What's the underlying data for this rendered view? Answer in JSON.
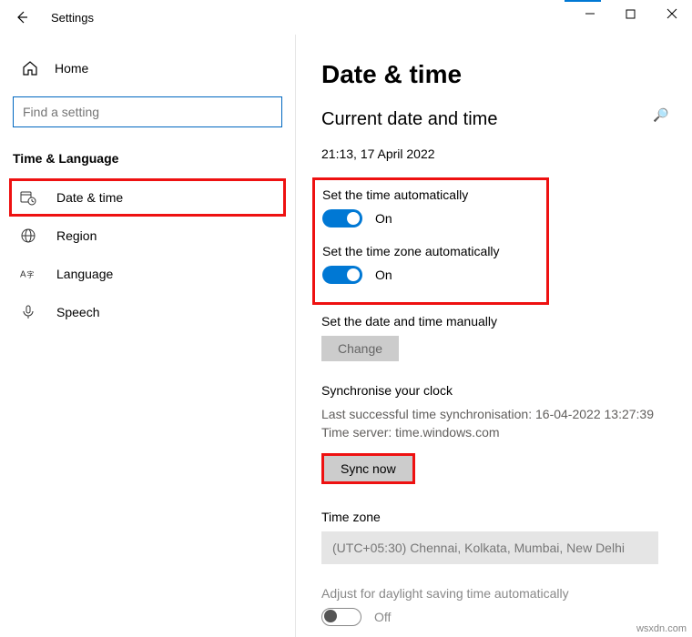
{
  "window": {
    "title": "Settings"
  },
  "sidebar": {
    "home": "Home",
    "search_placeholder": "Find a setting",
    "category": "Time & Language",
    "items": [
      {
        "label": "Date & time"
      },
      {
        "label": "Region"
      },
      {
        "label": "Language"
      },
      {
        "label": "Speech"
      }
    ]
  },
  "main": {
    "heading": "Date & time",
    "subheading": "Current date and time",
    "current_datetime": "21:13, 17 April 2022",
    "auto_time_label": "Set the time automatically",
    "auto_time_state": "On",
    "auto_tz_label": "Set the time zone automatically",
    "auto_tz_state": "On",
    "manual_label": "Set the date and time manually",
    "change_btn": "Change",
    "sync_heading": "Synchronise your clock",
    "sync_last": "Last successful time synchronisation: 16-04-2022 13:27:39",
    "sync_server": "Time server: time.windows.com",
    "sync_btn": "Sync now",
    "tz_heading": "Time zone",
    "tz_value": "(UTC+05:30) Chennai, Kolkata, Mumbai, New Delhi",
    "dst_label": "Adjust for daylight saving time automatically",
    "dst_state": "Off"
  },
  "watermark": "wsxdn.com"
}
